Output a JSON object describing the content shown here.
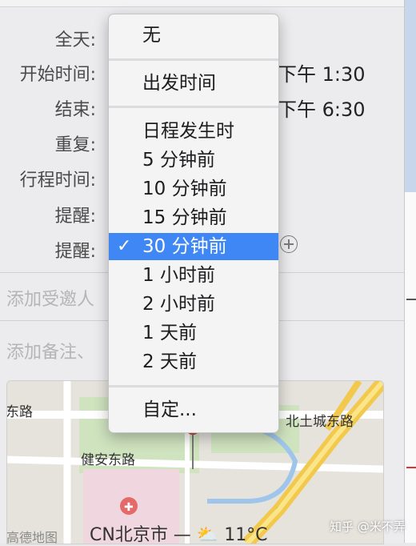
{
  "form": {
    "all_day_label": "全天:",
    "start_label": "开始时间:",
    "start_value": "下午 1:30",
    "end_label": "结束:",
    "end_value": "下午 6:30",
    "repeat_label": "重复:",
    "travel_label": "行程时间:",
    "alert_label_1": "提醒:",
    "alert_label_2": "提醒:",
    "invitees_placeholder": "添加受邀人",
    "notes_placeholder": "添加备注、"
  },
  "menu": {
    "items": [
      {
        "label": "无"
      },
      {
        "label": "出发时间"
      },
      {
        "label": "日程发生时"
      },
      {
        "label": "5 分钟前"
      },
      {
        "label": "10 分钟前"
      },
      {
        "label": "15 分钟前"
      },
      {
        "label": "30 分钟前",
        "selected": true,
        "check": "✓"
      },
      {
        "label": "1 小时前"
      },
      {
        "label": "2 小时前"
      },
      {
        "label": "1 天前"
      },
      {
        "label": "2 天前"
      },
      {
        "label": "自定..."
      }
    ],
    "selected_color": "#3f87f5"
  },
  "map": {
    "road_1": "东路",
    "road_2": "北土城东路",
    "road_3": "健安东路",
    "caption": "CN北京市 — ⛅ 11°C",
    "brand": "高德地图"
  },
  "watermark": "知乎 @米不弄"
}
